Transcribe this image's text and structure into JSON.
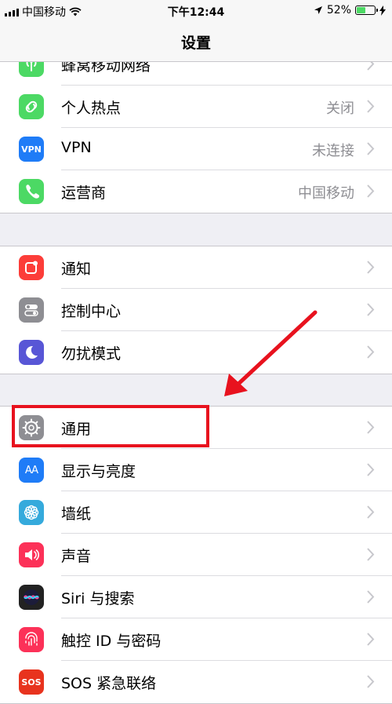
{
  "status_bar": {
    "carrier": "中国移动",
    "time": "下午12:44",
    "battery_percent": "52%",
    "battery_level": 0.52,
    "wifi_icon": "wifi-icon",
    "location_icon": "location-arrow-icon",
    "charging_icon": "charging-bolt-icon"
  },
  "nav": {
    "title": "设置"
  },
  "groups": [
    {
      "items": [
        {
          "label": "蜂窝移动网络",
          "value": "",
          "icon": "cellular-antenna-icon",
          "color": "#4cd964"
        },
        {
          "label": "个人热点",
          "value": "关闭",
          "icon": "personal-hotspot-icon",
          "color": "#4cd964"
        },
        {
          "label": "VPN",
          "value": "未连接",
          "icon": "vpn-icon",
          "icon_text": "VPN",
          "color": "#1f7cf7"
        },
        {
          "label": "运营商",
          "value": "中国移动",
          "icon": "phone-icon",
          "color": "#4cd964"
        }
      ]
    },
    {
      "items": [
        {
          "label": "通知",
          "value": "",
          "icon": "notifications-icon",
          "color": "#fc3d39"
        },
        {
          "label": "控制中心",
          "value": "",
          "icon": "control-center-icon",
          "color": "#8e8e93"
        },
        {
          "label": "勿扰模式",
          "value": "",
          "icon": "moon-icon",
          "color": "#5856d6"
        }
      ]
    },
    {
      "items": [
        {
          "label": "通用",
          "value": "",
          "icon": "gear-icon",
          "color": "#8e8e93"
        },
        {
          "label": "显示与亮度",
          "value": "",
          "icon": "display-brightness-icon",
          "icon_text": "AA",
          "color": "#1f7cf7"
        },
        {
          "label": "墙纸",
          "value": "",
          "icon": "wallpaper-flower-icon",
          "color": "#35aadc"
        },
        {
          "label": "声音",
          "value": "",
          "icon": "speaker-icon",
          "color": "#fc3158"
        },
        {
          "label": "Siri 与搜索",
          "value": "",
          "icon": "siri-icon",
          "color": "#222222"
        },
        {
          "label": "触控 ID 与密码",
          "value": "",
          "icon": "fingerprint-icon",
          "color": "#fc3158"
        },
        {
          "label": "SOS 紧急联络",
          "value": "",
          "icon": "sos-icon",
          "icon_text": "SOS",
          "color": "#e8331e"
        }
      ]
    }
  ],
  "annotation": {
    "highlight_color": "#e8121e",
    "arrow_color": "#e8121e"
  }
}
